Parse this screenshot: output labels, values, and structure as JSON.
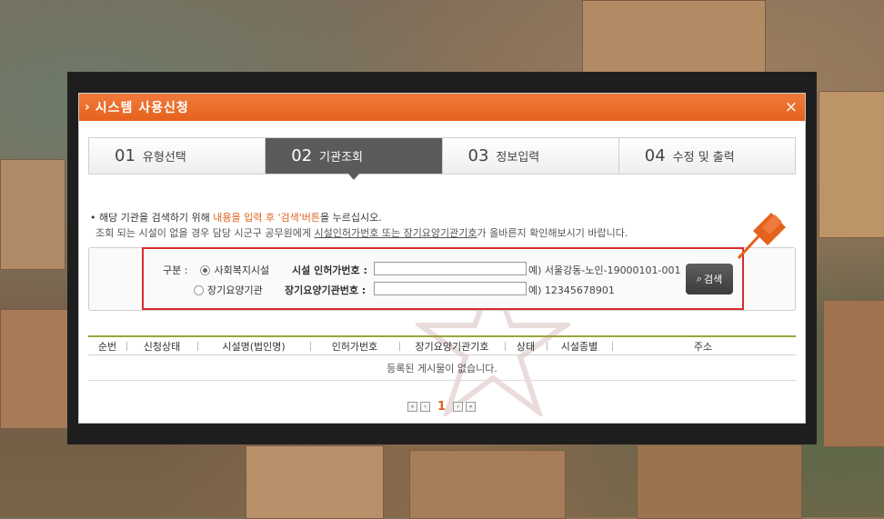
{
  "dialog": {
    "title": "시스템 사용신청",
    "close_icon": "×"
  },
  "steps": [
    {
      "num": "01",
      "label": "유형선택"
    },
    {
      "num": "02",
      "label": "기관조회"
    },
    {
      "num": "03",
      "label": "정보입력"
    },
    {
      "num": "04",
      "label": "수정 및 출력"
    }
  ],
  "notice": {
    "line1_prefix": "• 해당 기관을 검색하기 위해 ",
    "line1_highlight": "내용을 입력 후 '검색'버튼",
    "line1_suffix": "을 누르십시오.",
    "line2_prefix": "조회 되는 시설이 없을 경우 담당 시군구 공무원에게 ",
    "line2_link1": "시설인허가번호 또는 장기요양기관기호",
    "line2_suffix": "가 올바른지 확인해보시기 바랍니다."
  },
  "search": {
    "category_label": "구분 :",
    "option1": "사회복지시설",
    "option2": "장기요양기관",
    "field1_label": "시설 인허가번호 :",
    "field2_label": "장기요양기관번호 :",
    "field1_value": "",
    "field2_value": "",
    "example1": "예) 서울강동-노인-19000101-001",
    "example2": "예) 12345678901",
    "search_button": "검색"
  },
  "table": {
    "headers": [
      "순번",
      "신청상태",
      "시설명(법인명)",
      "인허가번호",
      "장기요양기관기호",
      "상태",
      "시설종별",
      "주소"
    ],
    "empty_message": "등록된 게시물이 없습니다."
  },
  "pager": {
    "first": "«",
    "prev": "‹",
    "current": "1",
    "next": "›",
    "last": "»"
  },
  "colors": {
    "accent": "#e5621c",
    "highlight_box": "#d92b2b",
    "active_step": "#5b5b5b"
  }
}
